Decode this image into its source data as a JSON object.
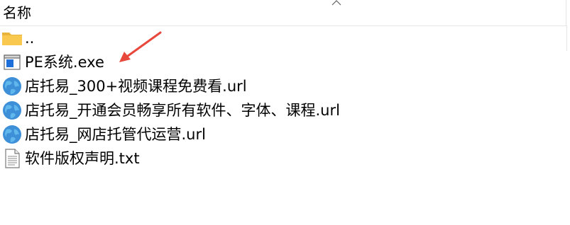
{
  "header": {
    "name_column_label": "名称",
    "sort_icon": "chevron-up-icon"
  },
  "files": [
    {
      "name": "..",
      "icon": "folder-icon"
    },
    {
      "name": "PE系统.exe",
      "icon": "application-exe-icon"
    },
    {
      "name": "店托易_300+视频课程免费看.url",
      "icon": "globe-url-icon"
    },
    {
      "name": "店托易_开通会员畅享所有软件、字体、课程.url",
      "icon": "globe-url-icon"
    },
    {
      "name": "店托易_网店托管代运营.url",
      "icon": "globe-url-icon"
    },
    {
      "name": "软件版权声明.txt",
      "icon": "text-document-icon"
    }
  ],
  "annotation": {
    "arrow_color": "#e8473b",
    "arrow_target": "PE系统.exe"
  },
  "colors": {
    "folder": "#f8c94e",
    "globe": "#3d8fd8",
    "exe_blue": "#1e6fd9",
    "divider": "#e5e5e5"
  }
}
